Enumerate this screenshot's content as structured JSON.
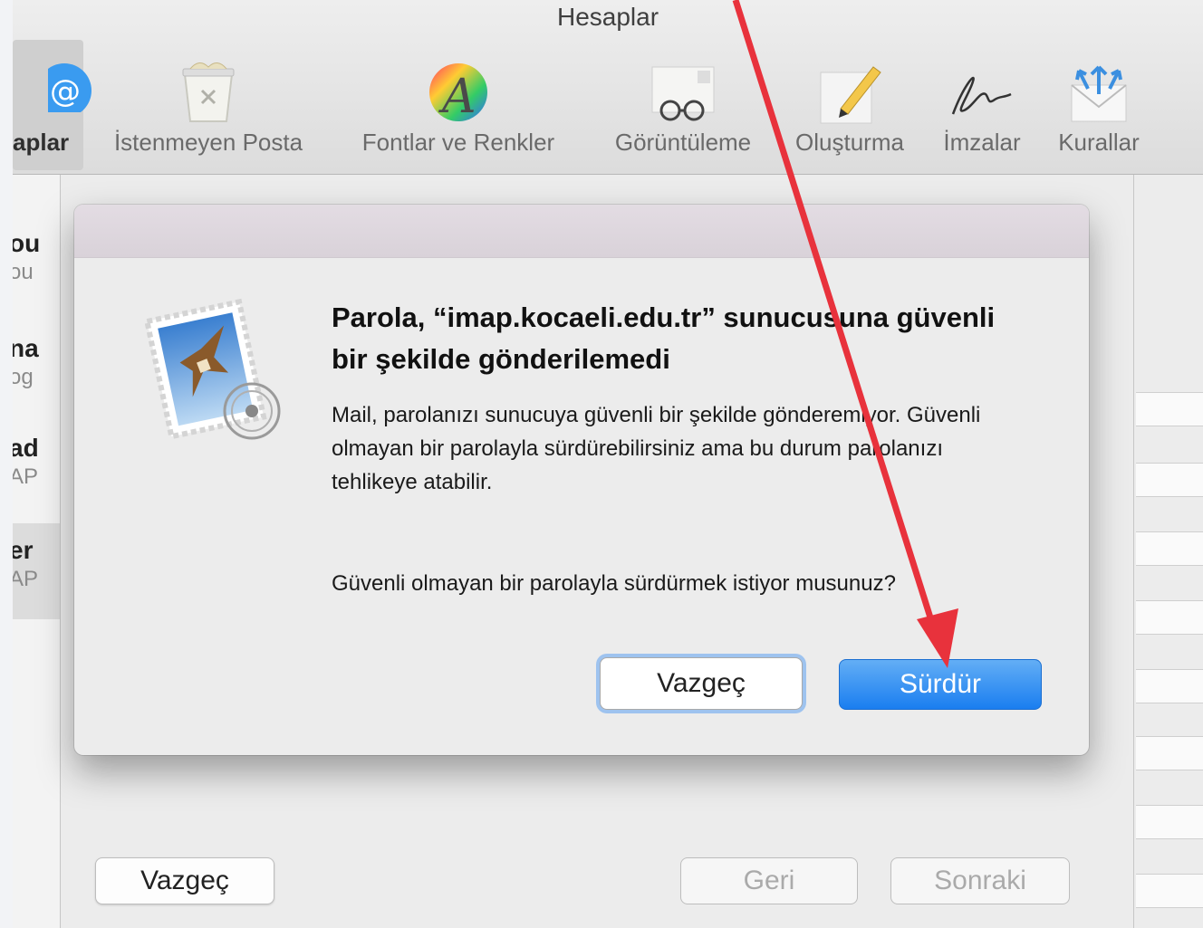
{
  "window": {
    "title": "Hesaplar"
  },
  "toolbar": {
    "items": [
      {
        "label": "aplar",
        "icon": "at-sign-icon",
        "selected": true
      },
      {
        "label": "İstenmeyen Posta",
        "icon": "junk-trash-icon"
      },
      {
        "label": "Fontlar ve Renkler",
        "icon": "fonts-colors-icon"
      },
      {
        "label": "Görüntüleme",
        "icon": "viewing-glasses-icon"
      },
      {
        "label": "Oluşturma",
        "icon": "compose-pencil-icon"
      },
      {
        "label": "İmzalar",
        "icon": "signature-icon"
      },
      {
        "label": "Kurallar",
        "icon": "rules-envelope-icon"
      }
    ]
  },
  "accounts_list": {
    "rows": [
      {
        "line1": "ou",
        "line2": "ou"
      },
      {
        "line1": "na",
        "line2": "og"
      },
      {
        "line1": "ad",
        "line2": "AP"
      },
      {
        "line1": "er",
        "line2": "AP",
        "selected": true
      }
    ]
  },
  "sheet": {
    "cancel_label": "Vazgeç",
    "back_label": "Geri",
    "next_label": "Sonraki"
  },
  "alert": {
    "heading": "Parola, “imap.kocaeli.edu.tr” sunucusuna güvenli bir şekilde gönderilemedi",
    "body": "Mail, parolanızı sunucuya güvenli bir şekilde gönderemiyor. Güvenli olmayan bir parolayla sürdürebilirsiniz ama bu durum parolanızı tehlikeye atabilir.",
    "question": "Güvenli olmayan bir parolayla sürdürmek istiyor musunuz?",
    "cancel_label": "Vazgeç",
    "continue_label": "Sürdür",
    "icon": "mail-stamp-icon"
  },
  "colors": {
    "accent_blue": "#1a7ef0",
    "annotation_arrow": "#e8323c"
  }
}
